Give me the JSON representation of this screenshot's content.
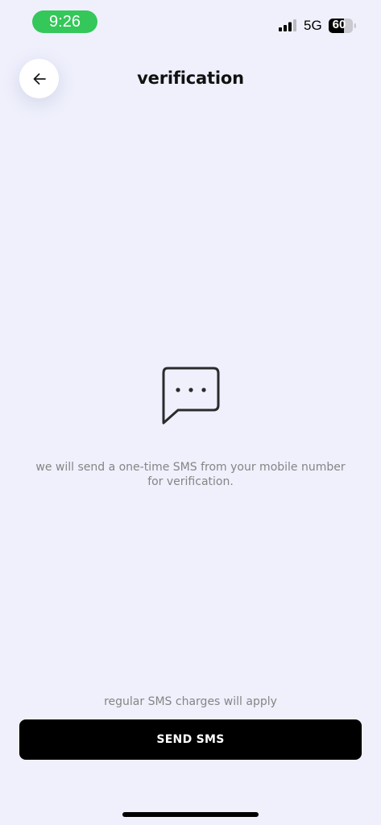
{
  "status_bar": {
    "time": "9:26",
    "network": "5G",
    "battery": "60",
    "signal_icon": "cellular-signal-icon",
    "battery_icon": "battery-icon"
  },
  "header": {
    "back_icon": "arrow-left-icon",
    "title": "verification"
  },
  "main": {
    "icon": "chat-bubble-icon",
    "description": "we will send a one-time SMS from your mobile number for verification."
  },
  "footer": {
    "charges_note": "regular SMS charges will apply",
    "send_label": "SEND SMS"
  },
  "colors": {
    "background": "#eff0fc",
    "time_pill": "#34c759",
    "primary_button": "#000000",
    "muted_text": "#858585"
  }
}
